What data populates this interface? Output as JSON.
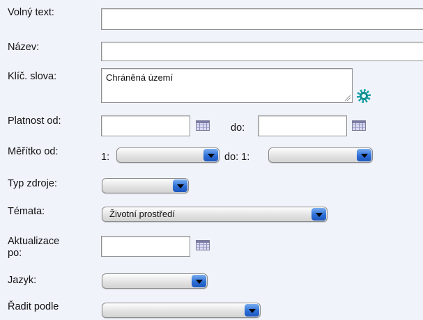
{
  "form": {
    "free_text": {
      "label": "Volný text:",
      "value": ""
    },
    "name": {
      "label": "Název:",
      "value": ""
    },
    "keywords": {
      "label": "Klíč. slova:",
      "value": "Chráněná území",
      "icon": "gear-icon"
    },
    "validity": {
      "label": "Platnost od:",
      "from_value": "",
      "to_label": "do:",
      "to_value": "",
      "icon": "calendar-icon"
    },
    "scale": {
      "label": "Měřítko od:",
      "from_prefix": "1:",
      "from_value": "",
      "to_prefix": "do: 1:",
      "to_value": ""
    },
    "resource_type": {
      "label": "Typ zdroje:",
      "value": ""
    },
    "topics": {
      "label": "Témata:",
      "value": "Životní prostředí"
    },
    "updated_after": {
      "label_line1": "Aktualizace",
      "label_line2": "po:",
      "value": ""
    },
    "language": {
      "label": "Jazyk:",
      "value": ""
    },
    "sort_by": {
      "label": "Řadit podle",
      "value": ""
    }
  },
  "colors": {
    "background": "#f1f3fb",
    "select_arrow": "#2d6fd6",
    "gear": "#1aa3a7"
  }
}
